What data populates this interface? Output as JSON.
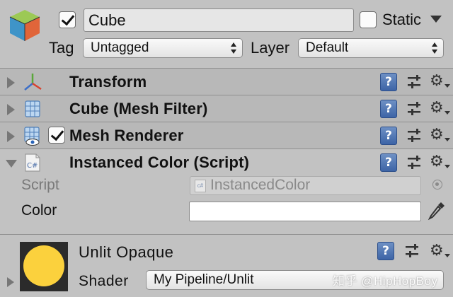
{
  "header": {
    "active": true,
    "name": "Cube",
    "static_label": "Static",
    "static": false,
    "tag_label": "Tag",
    "tag_value": "Untagged",
    "layer_label": "Layer",
    "layer_value": "Default"
  },
  "components": [
    {
      "title": "Transform",
      "icon": "transform-icon",
      "expanded": false,
      "has_toggle": false
    },
    {
      "title": "Cube (Mesh Filter)",
      "icon": "mesh-filter-icon",
      "expanded": false,
      "has_toggle": false
    },
    {
      "title": "Mesh Renderer",
      "icon": "mesh-renderer-icon",
      "expanded": false,
      "has_toggle": true,
      "enabled": true
    },
    {
      "title": "Instanced Color (Script)",
      "icon": "csharp-script-icon",
      "expanded": true,
      "has_toggle": false
    }
  ],
  "script_fields": {
    "script_label": "Script",
    "script_value": "InstancedColor",
    "script_icon_text": "c#",
    "component_icon_text": "C#",
    "color_label": "Color",
    "color_value": "#ffffff"
  },
  "material": {
    "name": "Unlit Opaque",
    "shader_label": "Shader",
    "shader_value": "My Pipeline/Unlit",
    "preview_color": "#fbd13d"
  },
  "icons": {
    "help": "?",
    "gear": "⚙"
  },
  "watermark": "知乎 @HipHopBoy"
}
